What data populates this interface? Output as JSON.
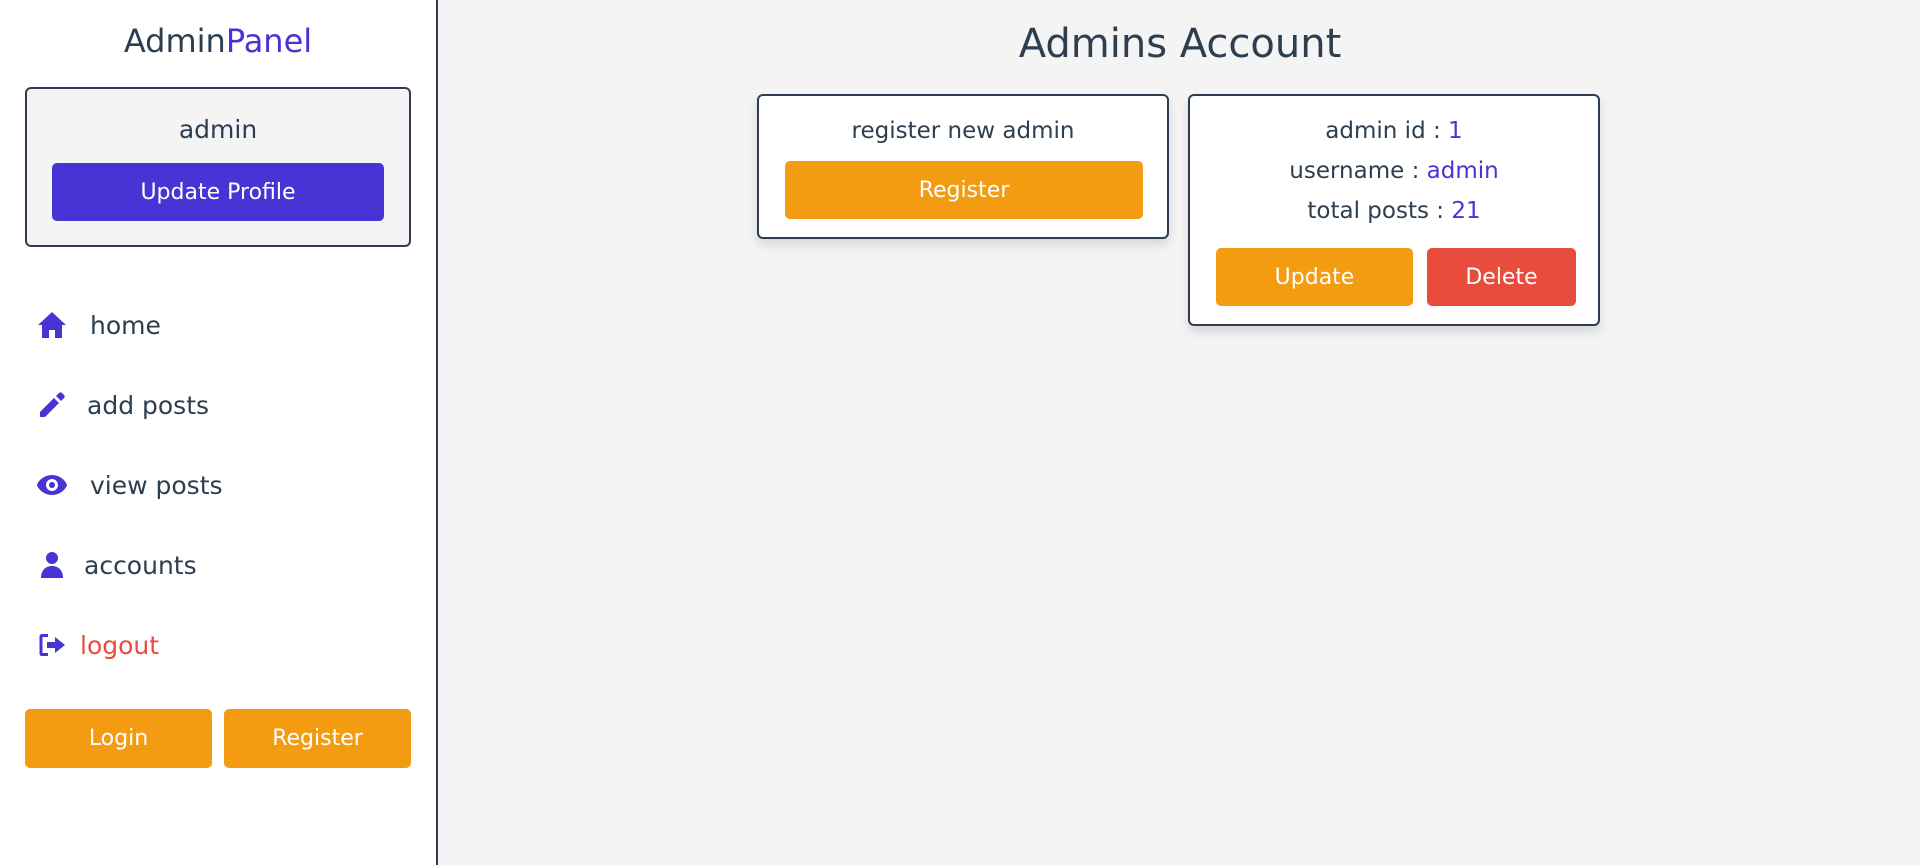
{
  "sidebar": {
    "logo": {
      "part1": "Admin",
      "part2": "Panel"
    },
    "profile": {
      "name": "admin",
      "update_label": "Update Profile"
    },
    "nav": [
      {
        "label": "home",
        "icon": "home-icon"
      },
      {
        "label": "add posts",
        "icon": "pencil-icon"
      },
      {
        "label": "view posts",
        "icon": "eye-icon"
      },
      {
        "label": "accounts",
        "icon": "user-icon"
      },
      {
        "label": "logout",
        "icon": "logout-icon"
      }
    ],
    "login_label": "Login",
    "register_label": "Register"
  },
  "main": {
    "title": "Admins Account",
    "register_card": {
      "text": "register new admin",
      "button_label": "Register"
    },
    "admin_card": {
      "id_label": "admin id : ",
      "id_value": "1",
      "username_label": "username : ",
      "username_value": "admin",
      "posts_label": "total posts : ",
      "posts_value": "21",
      "update_label": "Update",
      "delete_label": "Delete"
    }
  },
  "colors": {
    "accent": "#4834d4",
    "orange": "#f39c12",
    "red": "#e74c3c",
    "dark": "#2c3e50"
  }
}
